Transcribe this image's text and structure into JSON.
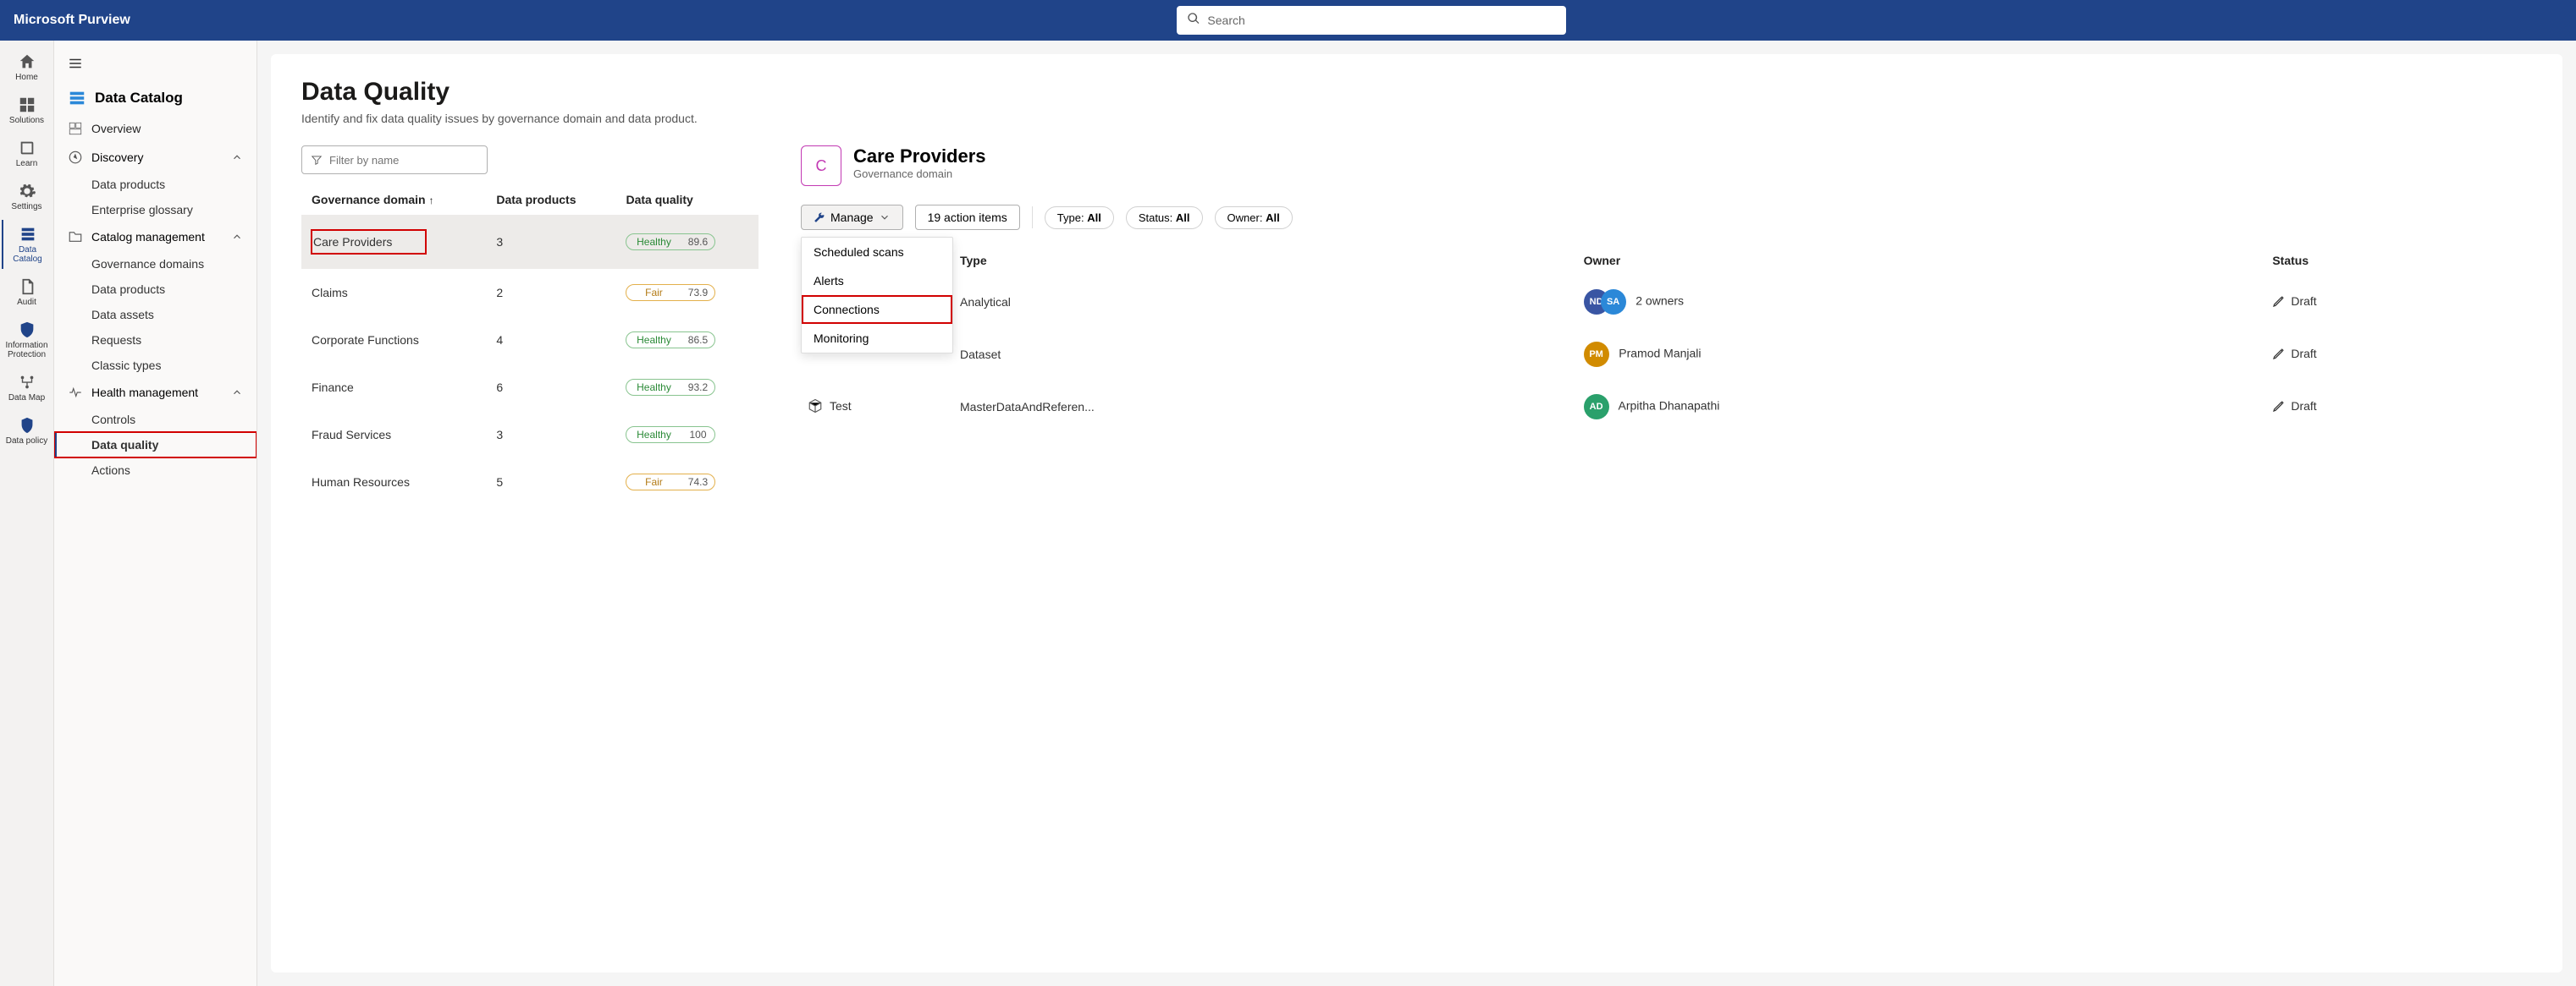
{
  "brand": "Microsoft Purview",
  "search": {
    "placeholder": "Search"
  },
  "rail": {
    "items": [
      {
        "label": "Home",
        "icon": "home"
      },
      {
        "label": "Solutions",
        "icon": "apps"
      },
      {
        "label": "Learn",
        "icon": "book"
      },
      {
        "label": "Settings",
        "icon": "gear"
      },
      {
        "label": "Data Catalog",
        "icon": "catalog",
        "active": true
      },
      {
        "label": "Audit",
        "icon": "audit"
      },
      {
        "label": "Information Protection",
        "icon": "shield"
      },
      {
        "label": "Data Map",
        "icon": "map"
      },
      {
        "label": "Data policy",
        "icon": "policy"
      }
    ]
  },
  "sidenav": {
    "header": "Data Catalog",
    "overview": "Overview",
    "groups": {
      "discovery": {
        "label": "Discovery",
        "items": [
          "Data products",
          "Enterprise glossary"
        ]
      },
      "catalog_mgmt": {
        "label": "Catalog management",
        "items": [
          "Governance domains",
          "Data products",
          "Data assets",
          "Requests",
          "Classic types"
        ]
      },
      "health_mgmt": {
        "label": "Health management",
        "items": [
          "Controls",
          "Data quality",
          "Actions"
        ],
        "selected": "Data quality"
      }
    }
  },
  "page": {
    "title": "Data Quality",
    "subtitle": "Identify and fix data quality issues by governance domain and data product."
  },
  "filter": {
    "placeholder": "Filter by name"
  },
  "domain_table": {
    "cols": {
      "c1": "Governance domain",
      "c2": "Data products",
      "c3": "Data quality"
    },
    "rows": [
      {
        "name": "Care Providers",
        "count": "3",
        "q_label": "Healthy",
        "q_score": "89.6",
        "status": "healthy",
        "selected": true
      },
      {
        "name": "Claims",
        "count": "2",
        "q_label": "Fair",
        "q_score": "73.9",
        "status": "fair"
      },
      {
        "name": "Corporate Functions",
        "count": "4",
        "q_label": "Healthy",
        "q_score": "86.5",
        "status": "healthy"
      },
      {
        "name": "Finance",
        "count": "6",
        "q_label": "Healthy",
        "q_score": "93.2",
        "status": "healthy"
      },
      {
        "name": "Fraud Services",
        "count": "3",
        "q_label": "Healthy",
        "q_score": "100",
        "status": "healthy"
      },
      {
        "name": "Human Resources",
        "count": "5",
        "q_label": "Fair",
        "q_score": "74.3",
        "status": "fair"
      }
    ]
  },
  "detail": {
    "initial": "C",
    "title": "Care Providers",
    "subtitle": "Governance domain",
    "manage_label": "Manage",
    "actions_label": "19 action items",
    "manage_menu": [
      "Scheduled scans",
      "Alerts",
      "Connections",
      "Monitoring"
    ],
    "pills": [
      {
        "k": "Type",
        "v": "All"
      },
      {
        "k": "Status",
        "v": "All"
      },
      {
        "k": "Owner",
        "v": "All"
      }
    ],
    "products": {
      "cols": {
        "c2": "Type",
        "c3": "Owner",
        "c4": "Status"
      },
      "rows": [
        {
          "type": "Analytical",
          "owner_text": "2 owners",
          "avatars": [
            "nd",
            "sa"
          ],
          "status": "Draft"
        },
        {
          "type": "Dataset",
          "owner_text": "Pramod Manjali",
          "avatars": [
            "pm"
          ],
          "status": "Draft"
        },
        {
          "name": "Test",
          "type": "MasterDataAndReferen...",
          "owner_text": "Arpitha Dhanapathi",
          "avatars": [
            "ad"
          ],
          "status": "Draft"
        }
      ]
    }
  }
}
